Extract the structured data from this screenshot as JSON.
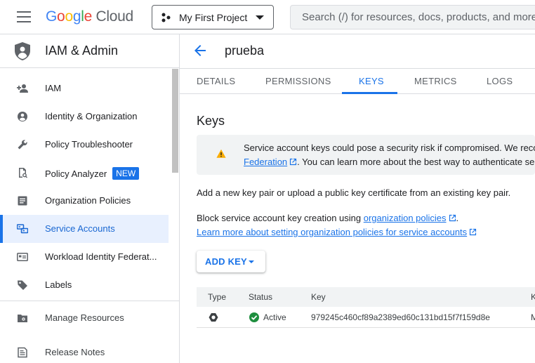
{
  "header": {
    "logo": {
      "g1": "G",
      "g2": "o",
      "g3": "o",
      "g4": "g",
      "g5": "l",
      "g6": "e",
      "cloud": " Cloud"
    },
    "project": "My First Project",
    "search_placeholder": "Search (/) for resources, docs, products, and more"
  },
  "sidebar": {
    "title": "IAM & Admin",
    "items": [
      {
        "label": "IAM",
        "icon": "person-add-icon"
      },
      {
        "label": "Identity & Organization",
        "icon": "account-circle-icon"
      },
      {
        "label": "Policy Troubleshooter",
        "icon": "wrench-icon"
      },
      {
        "label": "Policy Analyzer",
        "icon": "policy-analyzer-icon",
        "badge": "NEW"
      },
      {
        "label": "Organization Policies",
        "icon": "document-list-icon"
      },
      {
        "label": "Service Accounts",
        "icon": "service-account-icon",
        "active": true
      },
      {
        "label": "Workload Identity Federat...",
        "icon": "id-card-icon"
      },
      {
        "label": "Labels",
        "icon": "tag-icon"
      }
    ],
    "bottom_items": [
      {
        "label": "Manage Resources",
        "icon": "folder-gear-icon"
      },
      {
        "label": "Release Notes",
        "icon": "notes-icon"
      }
    ]
  },
  "main": {
    "title": "prueba",
    "tabs": [
      "DETAILS",
      "PERMISSIONS",
      "KEYS",
      "METRICS",
      "LOGS"
    ],
    "active_tab": "KEYS",
    "section_title": "Keys",
    "warning": {
      "line1": "Service account keys could pose a security risk if compromised. We recommend you avoid downloading service account keys and instead use the Workload Identity",
      "link1": "Federation",
      "line2": ". You can learn more about the best way to authenticate service accounts on Google Cloud here."
    },
    "description": "Add a new key pair or upload a public key certificate from an existing key pair.",
    "block_text": "Block service account key creation using ",
    "block_link": "organization policies",
    "block_end": ".",
    "learn_link": "Learn more about setting organization policies for service accounts",
    "add_key_label": "ADD KEY",
    "table": {
      "columns": [
        "Type",
        "Status",
        "Key",
        "K"
      ],
      "rows": [
        {
          "type_icon": "key-type-icon",
          "status": "Active",
          "key": "979245c460cf89a2389ed60c131bd15f7f159d8e",
          "extra": "M"
        }
      ]
    }
  },
  "colors": {
    "accent": "#1a73e8",
    "active_bg": "#e8f0fe",
    "success": "#1e8e3e",
    "warning": "#f9ab00"
  }
}
